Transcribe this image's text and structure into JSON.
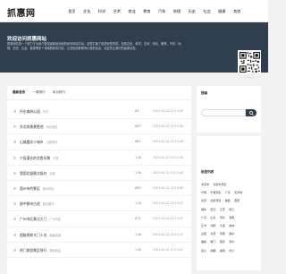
{
  "header": {
    "logo": "抓惠网",
    "nav": [
      "首页",
      "文化",
      "科学",
      "艺术",
      "商业",
      "教育",
      "汽车",
      "地理",
      "历史",
      "社会",
      "健康",
      "其他"
    ]
  },
  "hero": {
    "title": "欢迎访问抓惠网站",
    "desc": "抓惠网站是一个致力于为用户提供最新最全面的资讯网站平台，这里汇聚了各类优质内容，包括文化、科学、艺术、商业、教育、汽车、地理、历史、社会、健康等多个领域的精彩内容，让您轻松获取有价值的信息，欢迎关注我们的最新动态。",
    "qr_caption": "扫码关注"
  },
  "main": {
    "tabs": [
      "最新发布",
      "一周排行",
      "本月排行"
    ],
    "rows": [
      {
        "title": "丹东森林公园",
        "tag": "丹东",
        "num": "84",
        "date": "2023-04-22 15:13:49"
      },
      {
        "title": "东北的美景胜地",
        "tag": "东北地区",
        "num": "852",
        "date": "2023-04-22 15:13:48"
      },
      {
        "title": "山城重庆十城市",
        "tag": "山城重庆",
        "num": "681",
        "date": "2023-04-22 15:13:48"
      },
      {
        "title": "宁夏著名的名胜风景",
        "tag": "宁夏",
        "num": "1.4k",
        "date": "2023-04-22 15:13:48"
      },
      {
        "title": "我国北极圈北极村",
        "tag": "北极",
        "num": "1.3k",
        "date": "2023-04-22 15:13:48"
      },
      {
        "title": "惠州市的景区",
        "tag": "惠州市区",
        "num": "695",
        "date": "2023-04-22 15:13:48"
      },
      {
        "title": "陕中都市古迹",
        "tag": "陕中都市",
        "num": "1.0k",
        "date": "2023-04-22 15:13:47"
      },
      {
        "title": "广州市区景点大门",
        "tag": "广州市区",
        "num": "672",
        "date": "2023-04-22 15:13:47"
      },
      {
        "title": "超级榜样大门十名",
        "tag": "超级名城",
        "num": "1.5k",
        "date": "2023-04-22 15:13:47"
      },
      {
        "title": "热门旅游景区排行",
        "tag": "旅游景区",
        "num": "1.0k",
        "date": "2023-04-22 15:13:47"
      }
    ]
  },
  "sidebar": {
    "search_title": "搜索",
    "search_placeholder": "",
    "tags_title": "标签列表",
    "tags": [
      [
        "北京市",
        "北京市景区"
      ],
      [
        "宁夏",
        "宁夏景区",
        "广东",
        "天津市"
      ],
      [
        "北京",
        "北京景区",
        "陕西",
        "西安"
      ],
      [
        "湖北",
        "武汉",
        "江苏",
        "浙江"
      ],
      [
        "广东",
        "山东",
        "河北",
        "海南"
      ],
      [
        "辽宁",
        "沈阳",
        "大连",
        "吉林"
      ],
      [
        "山西",
        "太原",
        "河南",
        "郑州"
      ],
      [
        "福建",
        "厦门",
        "南京",
        "苏州"
      ],
      [
        "四川",
        "成都",
        "湖南",
        "长沙"
      ]
    ]
  },
  "colors": {
    "hero_bg": "#2f3f50",
    "accent": "#2f3f50",
    "page_bg": "#f2f2f2"
  }
}
